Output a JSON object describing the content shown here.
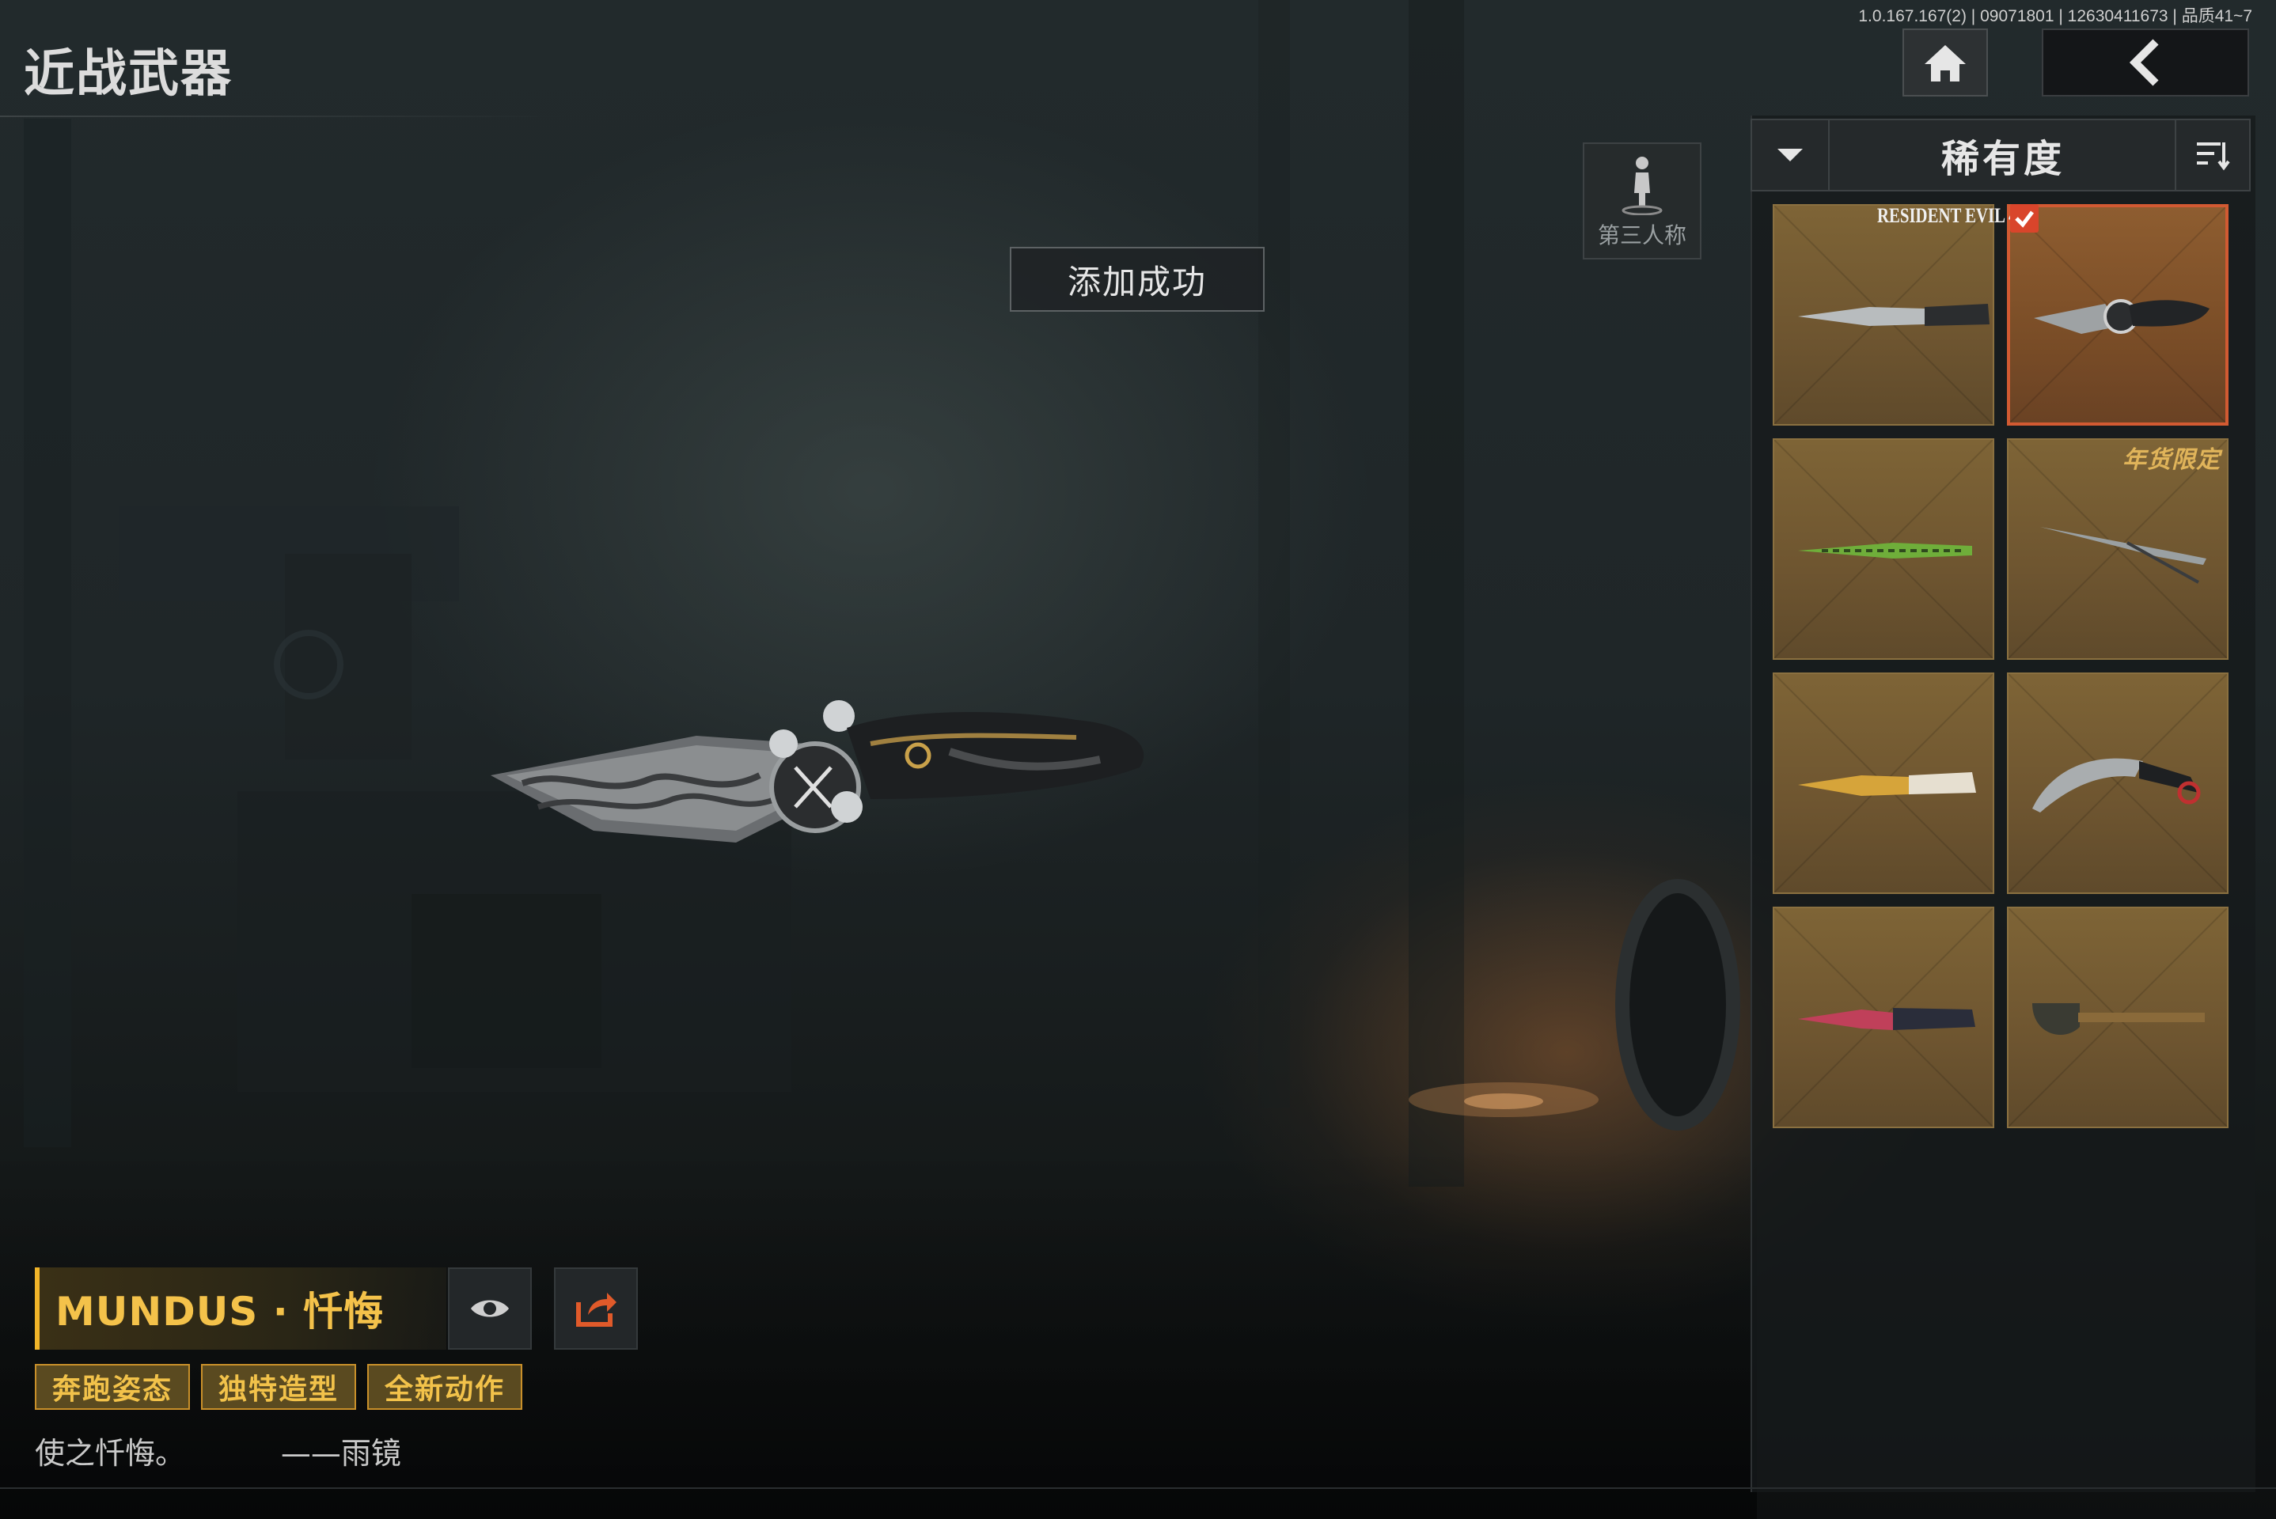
{
  "header": {
    "title": "近战武器",
    "version": "1.0.167.167(2) | 09071801 | 12630411673 | 品质41~7"
  },
  "nav": {
    "home_icon": "home-icon",
    "back_icon": "chevron-left-icon"
  },
  "view_toggle": {
    "label": "第三人称",
    "icon": "person-icon"
  },
  "toast": {
    "text": "添加成功"
  },
  "sort": {
    "label": "稀有度",
    "dropdown_icon": "chevron-down-icon",
    "order_icon": "sort-order-icon"
  },
  "inventory": {
    "badge_text": "RESIDENT EVIL 4",
    "limited_text": "年货限定",
    "items": [
      {
        "weapon": "combat-knife",
        "selected": false
      },
      {
        "weapon": "ornate-knife",
        "selected": true
      },
      {
        "weapon": "green-serrated-blade",
        "selected": false
      },
      {
        "weapon": "thin-blade",
        "selected": false
      },
      {
        "weapon": "gold-knife",
        "selected": false
      },
      {
        "weapon": "karambit",
        "selected": false
      },
      {
        "weapon": "red-knife",
        "selected": false
      },
      {
        "weapon": "shovel",
        "selected": false
      }
    ]
  },
  "weapon": {
    "name": "MUNDUS · 忏悔",
    "tags": [
      "奔跑姿态",
      "独特造型",
      "全新动作"
    ],
    "quote": "使之忏悔。",
    "author": "——雨镜"
  },
  "colors": {
    "accent": "#f0b429",
    "selected_border": "#d25a32",
    "item_bg": "#6e5530",
    "panel_bg": "#16191b"
  }
}
